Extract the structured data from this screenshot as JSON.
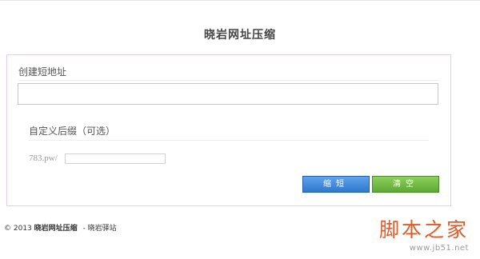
{
  "app": {
    "title": "晓岩网址压缩"
  },
  "form": {
    "url_label": "创建短地址",
    "url_value": "",
    "suffix_label": "自定义后缀（可选）",
    "domain_prefix": "783.pw/",
    "suffix_value": ""
  },
  "buttons": {
    "compress": "缩短",
    "clear": "清空"
  },
  "footer": {
    "copyright": "© 2013",
    "brand": "晓岩网址压缩",
    "separator": "-",
    "link": "晓岩驿站"
  },
  "watermark": {
    "text": "脚本之家",
    "url": "www.jb51.net"
  },
  "colors": {
    "compress_button": "#2f78cf",
    "clear_button": "#5ea834",
    "panel_border": "#e3cfe3",
    "watermark": "#e35a2a"
  }
}
